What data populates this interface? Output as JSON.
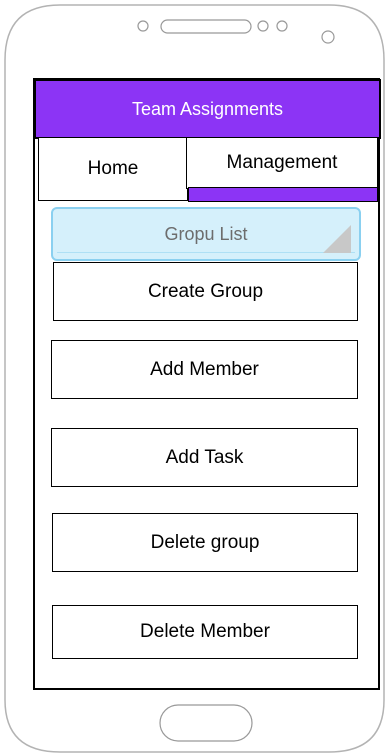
{
  "header": {
    "title": "Team Assignments"
  },
  "tabs": [
    {
      "label": "Home"
    },
    {
      "label": "Management"
    }
  ],
  "group_list": {
    "label": "Gropu List"
  },
  "actions": [
    {
      "label": "Create Group"
    },
    {
      "label": "Add Member"
    },
    {
      "label": "Add Task"
    },
    {
      "label": "Delete group"
    },
    {
      "label": "Delete Member"
    }
  ],
  "colors": {
    "accent": "#8c34f5",
    "dropdown_fill": "#d5f0fb",
    "dropdown_border": "#8ad0f0",
    "phone_outline": "#b3b3b3"
  },
  "icons": {
    "speaker": "speaker-grille-icon",
    "camera": "camera-icon",
    "home_button": "home-button-icon",
    "dropdown": "dropdown-triangle-icon"
  }
}
